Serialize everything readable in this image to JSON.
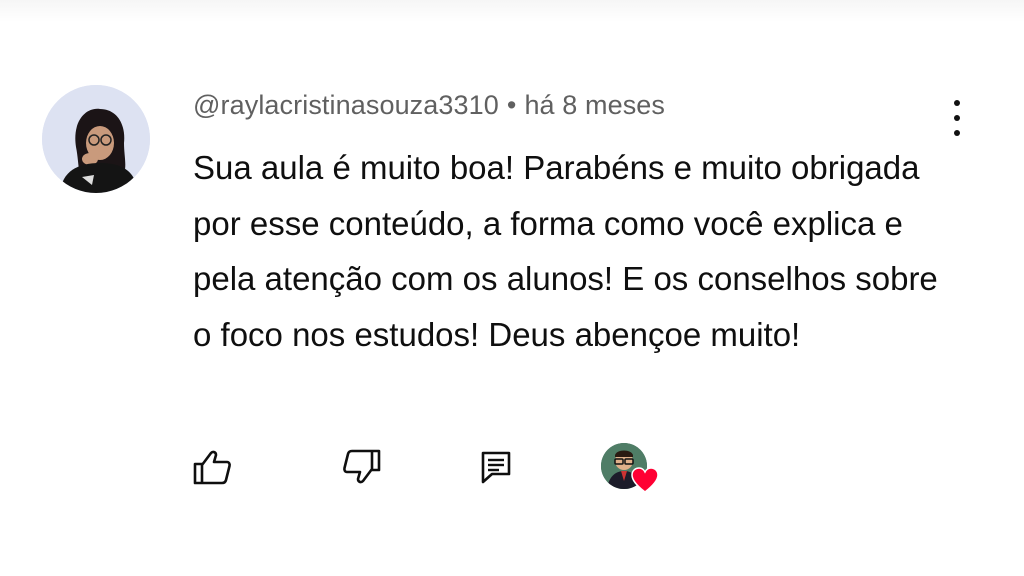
{
  "comment": {
    "author": "@raylacristinasouza3310",
    "separator": "•",
    "time": "há 8 meses",
    "text": "Sua aula é muito boa! Parabéns e muito obrigada por esse conteúdo, a forma como você explica e pela atenção com os alunos! E os conselhos sobre o foco nos estudos! Deus abençoe muito!"
  },
  "icons": {
    "avatar": "user-avatar",
    "menu": "more-vert-icon",
    "like": "thumbs-up-icon",
    "dislike": "thumbs-down-icon",
    "reply": "reply-comment-icon",
    "creator_heart": "creator-heart-icon"
  },
  "colors": {
    "text": "#0f0f0f",
    "meta": "#606060",
    "heart": "#ff0033"
  }
}
